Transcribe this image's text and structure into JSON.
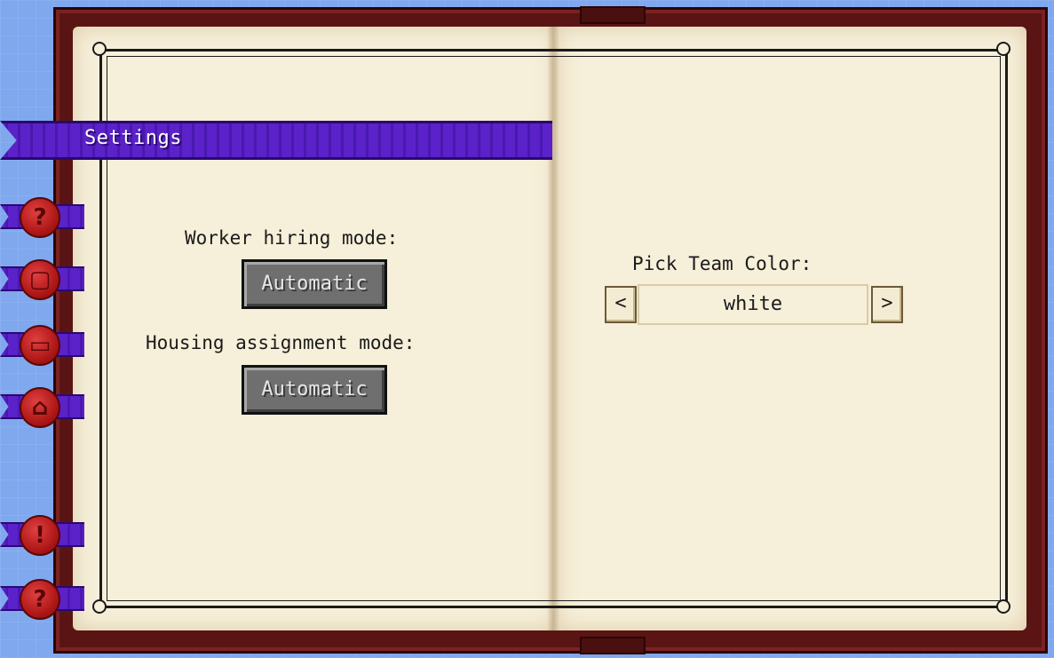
{
  "header": {
    "title": "Settings"
  },
  "sidebar": {
    "tabs": [
      {
        "icon": "question-seal-icon",
        "glyph": "?"
      },
      {
        "icon": "square-seal-icon",
        "glyph": "▢"
      },
      {
        "icon": "document-seal-icon",
        "glyph": "▭"
      },
      {
        "icon": "house-seal-icon",
        "glyph": "⌂"
      },
      {
        "icon": "exclamation-seal-icon",
        "glyph": "!"
      },
      {
        "icon": "question-seal-icon",
        "glyph": "?"
      }
    ]
  },
  "left_page": {
    "worker_hiring_label": "Worker hiring mode:",
    "worker_hiring_value": "Automatic",
    "housing_assignment_label": "Housing assignment mode:",
    "housing_assignment_value": "Automatic"
  },
  "right_page": {
    "team_color_label": "Pick Team Color:",
    "team_color_value": "white",
    "prev_label": "<",
    "next_label": ">"
  },
  "colors": {
    "ribbon": "#5a22c8",
    "cover": "#5a1414",
    "page": "#f6efd9",
    "seal": "#b01818"
  }
}
